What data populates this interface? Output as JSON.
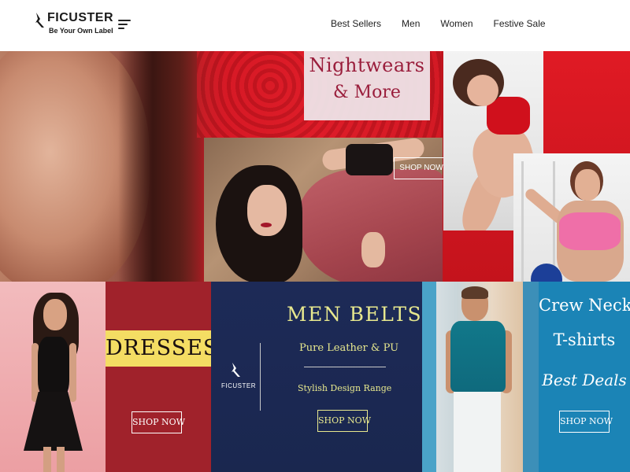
{
  "header": {
    "logo": {
      "name": "FICUSTER",
      "tagline": "Be Your Own Label"
    },
    "menu_icon": "hamburger-menu-icon",
    "nav": [
      {
        "label": "Best Sellers"
      },
      {
        "label": "Men"
      },
      {
        "label": "Women"
      },
      {
        "label": "Festive Sale"
      }
    ]
  },
  "hero": {
    "title_line1": "Nightwears",
    "title_line2": "& More",
    "shop_label": "SHOP NOW"
  },
  "tiles": {
    "dresses": {
      "title": "DRESSES",
      "shop_label": "SHOP NOW"
    },
    "belts": {
      "logo": "FICUSTER",
      "title": "MEN BELTS",
      "subtitle": "Pure Leather & PU",
      "tagline": "Stylish Design Range",
      "shop_label": "SHOP NOW"
    },
    "crew": {
      "line1": "Crew Neck",
      "line2": "T-shirts",
      "line3": "Best Deals",
      "shop_label": "SHOP NOW"
    }
  },
  "colors": {
    "hero_red": "#d81c26",
    "nightwear_text": "#9a1e3c",
    "dresses_bg": "#a0222b",
    "dresses_band": "#f4dd63",
    "belts_bg": "#1d2a57",
    "belts_text": "#e7e88e",
    "crew_bg": "#1b84b6"
  }
}
